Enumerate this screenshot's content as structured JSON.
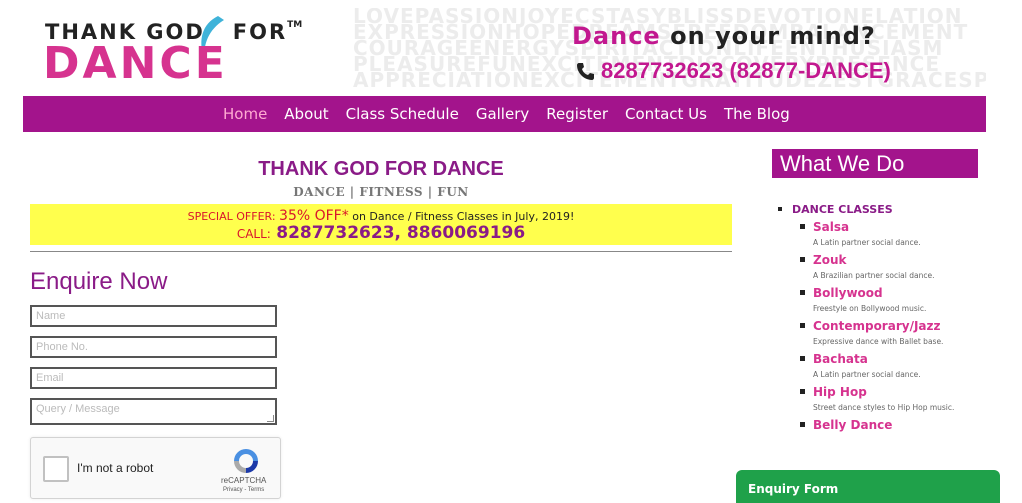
{
  "header": {
    "logo_top": "THANK GOD",
    "logo_for": "FOR",
    "logo_tm": "TM",
    "logo_bottom": "DANCE",
    "word_cloud": [
      "LOVEPASSIONJOYECSTASYBLISSDEVOTIONELATION",
      "EXPRESSIONHOPEDREAMSFREEDOMBALANCEMENT",
      "COURAGEENERGYSPIRITACTIONLIFEENTHUSIASM",
      "PLEASUREFUNEXCITEMENTDISCOVERYPRESENCE",
      "APPRECIATIONEXCITEMENTGRATITUDEZESTGRACESPIRIT"
    ],
    "tagline_dance": "Dance",
    "tagline_rest": " on your mind?",
    "phone": "8287732623 (82877-DANCE)"
  },
  "nav": {
    "items": [
      {
        "label": "Home",
        "active": true
      },
      {
        "label": "About"
      },
      {
        "label": "Class Schedule"
      },
      {
        "label": "Gallery"
      },
      {
        "label": "Register"
      },
      {
        "label": "Contact Us"
      },
      {
        "label": "The Blog"
      }
    ]
  },
  "main": {
    "title": "THANK GOD FOR DANCE",
    "subtitle": "DANCE | FITNESS | FUN",
    "offer_prefix": "SPECIAL OFFER:",
    "offer_highlight": "35% OFF*",
    "offer_rest": "on Dance / Fitness Classes in July, 2019!",
    "offer_call": "CALL:",
    "offer_numbers": "8287732623, 8860069196"
  },
  "form": {
    "title": "Enquire Now",
    "name_placeholder": "Name",
    "phone_placeholder": "Phone No.",
    "email_placeholder": "Email",
    "message_placeholder": "Query / Message",
    "captcha_label": "I'm not a robot",
    "captcha_brand": "reCAPTCHA",
    "captcha_links": "Privacy - Terms"
  },
  "sidebar": {
    "title": "What We Do",
    "category": "DANCE CLASSES",
    "items": [
      {
        "name": "Salsa",
        "desc": "A Latin partner social dance."
      },
      {
        "name": "Zouk",
        "desc": "A Brazilian partner social dance."
      },
      {
        "name": "Bollywood",
        "desc": "Freestyle on Bollywood music."
      },
      {
        "name": "Contemporary/Jazz",
        "desc": "Expressive dance with Ballet base."
      },
      {
        "name": "Bachata",
        "desc": "A Latin partner social dance."
      },
      {
        "name": "Hip Hop",
        "desc": "Street dance styles to Hip Hop music."
      },
      {
        "name": "Belly Dance",
        "desc": ""
      }
    ]
  },
  "enquiry_tab": "Enquiry Form",
  "colors": {
    "brand_purple": "#a3148c",
    "brand_pink": "#d6338f",
    "offer_yellow": "#ffff4d",
    "enquiry_green": "#1fa14a"
  }
}
